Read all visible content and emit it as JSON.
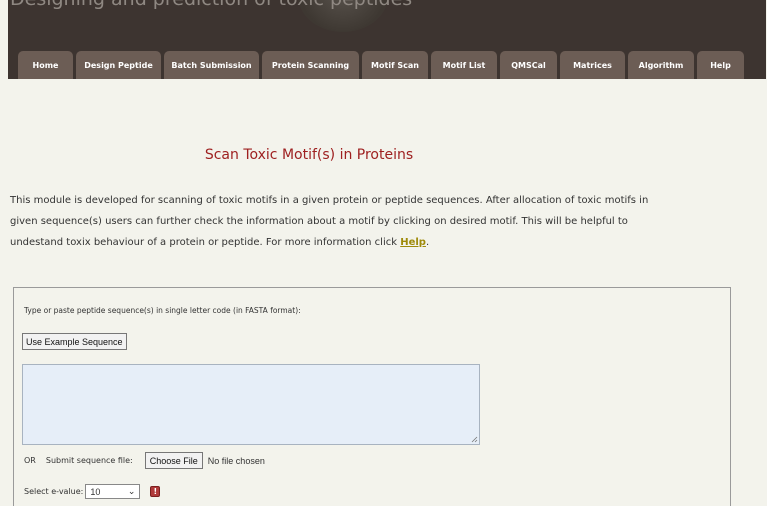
{
  "header": {
    "site_title": "Designing and prediction of toxic peptides"
  },
  "nav": {
    "tabs": [
      {
        "label": "Home"
      },
      {
        "label": "Design Peptide"
      },
      {
        "label": "Batch Submission"
      },
      {
        "label": "Protein Scanning"
      },
      {
        "label": "Motif Scan"
      },
      {
        "label": "Motif List"
      },
      {
        "label": "QMSCal"
      },
      {
        "label": "Matrices"
      },
      {
        "label": "Algorithm"
      },
      {
        "label": "Help"
      }
    ]
  },
  "main": {
    "title": "Scan Toxic Motif(s) in Proteins",
    "description": "This module is developed for scanning of toxic motifs in a given protein or peptide sequences. After allocation of toxic motifs in given sequence(s) users can further check the information about a motif by clicking on desired motif. This will be helpful to undestand toxix behaviour of a protein or peptide. For more information click ",
    "help_link": "Help",
    "description_end": "."
  },
  "form": {
    "sequence_label": "Type or paste peptide sequence(s) in single letter code (in FASTA format):",
    "example_button": "Use Example Sequence",
    "sequence_value": "",
    "or_label": "OR",
    "submit_file_label": "Submit sequence file:",
    "choose_file_button": "Choose File",
    "no_file_text": "No file chosen",
    "evalue_label": "Select e-value:",
    "evalue_selected": "10",
    "info_icon": "info-icon"
  },
  "colors": {
    "header_bg": "#3d3430",
    "tab_bg": "#6c5d55",
    "title_red": "#9e2020",
    "link_gold": "#9e8a0a",
    "page_bg": "#f3f3ec"
  }
}
